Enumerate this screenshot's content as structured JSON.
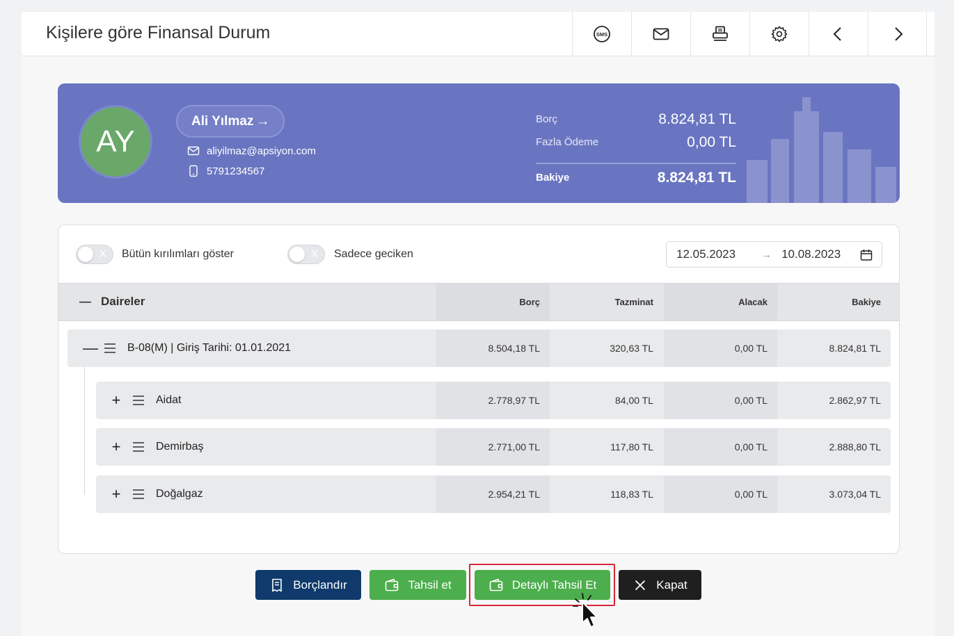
{
  "window": {
    "title": "Kişilere göre Finansal Durum"
  },
  "toolbar": {
    "icons": [
      "sms-icon",
      "mail-icon",
      "printer-icon",
      "settings-icon",
      "chevron-left-icon",
      "chevron-right-icon"
    ],
    "sms_text": "SMS"
  },
  "profile": {
    "initials": "AY",
    "name": "Ali Yılmaz",
    "arrow": "→",
    "email": "aliyilmaz@apsiyon.com",
    "phone": "5791234567",
    "debt_label": "Borç",
    "debt_value": "8.824,81 TL",
    "overpay_label": "Fazla Ödeme",
    "overpay_value": "0,00 TL",
    "balance_label": "Bakiye",
    "balance_value": "8.824,81 TL"
  },
  "filters": {
    "show_all_label": "Bütün kırılımları göster",
    "overdue_label": "Sadece geciken",
    "toggle_off_mark": "X",
    "date_from": "12.05.2023",
    "date_to": "10.08.2023",
    "date_arrow": "→"
  },
  "table": {
    "group_label": "Daireler",
    "collapse": "—",
    "expand": "+",
    "columns": [
      "Borç",
      "Tazminat",
      "Alacak",
      "Bakiye"
    ],
    "parent": {
      "label": "B-08(M) | Giriş Tarihi: 01.01.2021",
      "values": [
        "8.504,18 TL",
        "320,63 TL",
        "0,00 TL",
        "8.824,81 TL"
      ]
    },
    "children": [
      {
        "label": "Aidat",
        "values": [
          "2.778,97 TL",
          "84,00 TL",
          "0,00 TL",
          "2.862,97 TL"
        ]
      },
      {
        "label": "Demirbaş",
        "values": [
          "2.771,00 TL",
          "117,80 TL",
          "0,00 TL",
          "2.888,80 TL"
        ]
      },
      {
        "label": "Doğalgaz",
        "values": [
          "2.954,21 TL",
          "118,83 TL",
          "0,00 TL",
          "3.073,04 TL"
        ]
      }
    ]
  },
  "actions": {
    "debit_label": "Borçlandır",
    "collect_label": "Tahsil et",
    "detailed_collect_label": "Detaylı Tahsil Et",
    "close_label": "Kapat"
  },
  "colors": {
    "brand_purple": "#6a75c1",
    "navy": "#0f3a6b",
    "green": "#4cae4c",
    "dark": "#1f1f1f",
    "highlight_red": "#d8273a"
  }
}
